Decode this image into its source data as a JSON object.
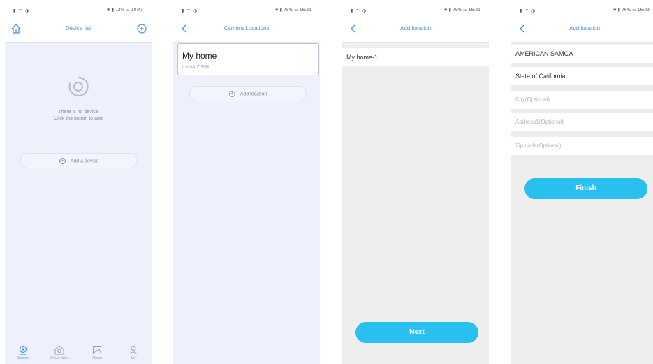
{
  "screens": [
    {
      "status": {
        "left": "▮ ⌔ ◑",
        "right": "✱ ▮ 72% ▭ 10:43"
      },
      "title": "Device list",
      "empty_line1": "There is no device",
      "empty_line2": "Click the button to add",
      "add_button": "Add a device",
      "tabs": [
        {
          "label": "Device",
          "icon": "camera-icon"
        },
        {
          "label": "Cloud video",
          "icon": "cloud-video-icon"
        },
        {
          "label": "Album",
          "icon": "album-icon"
        },
        {
          "label": "Me",
          "icon": "person-icon"
        }
      ]
    },
    {
      "status": {
        "left": "▮ ⌔ ◑",
        "right": "✱ ▮ 75% ▭ 16:21"
      },
      "title": "Camera Locations",
      "location_name": "My home",
      "location_sub": "CHINA,广东省...",
      "add_button": "Add location"
    },
    {
      "status": {
        "left": "▮ ⌔ ◑",
        "right": "✱ ▮ 75% ▭ 16:21"
      },
      "title": "Add location",
      "name_value": "My home-1",
      "next_button": "Next"
    },
    {
      "status": {
        "left": "▮ ⌔ ◑",
        "right": "✱ ▮ 76% ▭ 16:23"
      },
      "title": "Add location",
      "country_value": "AMERICAN SAMOA",
      "state_value": "State of California",
      "city_placeholder": "City(Optional)",
      "address_placeholder": "Address1(Optional)",
      "zip_placeholder": "Zip code(Optional)",
      "finish_button": "Finish"
    }
  ],
  "colors": {
    "accent": "#4a90e2",
    "cta": "#29c0ef",
    "bg_light": "#eef1fb",
    "bg_gray": "#eeeeee"
  }
}
